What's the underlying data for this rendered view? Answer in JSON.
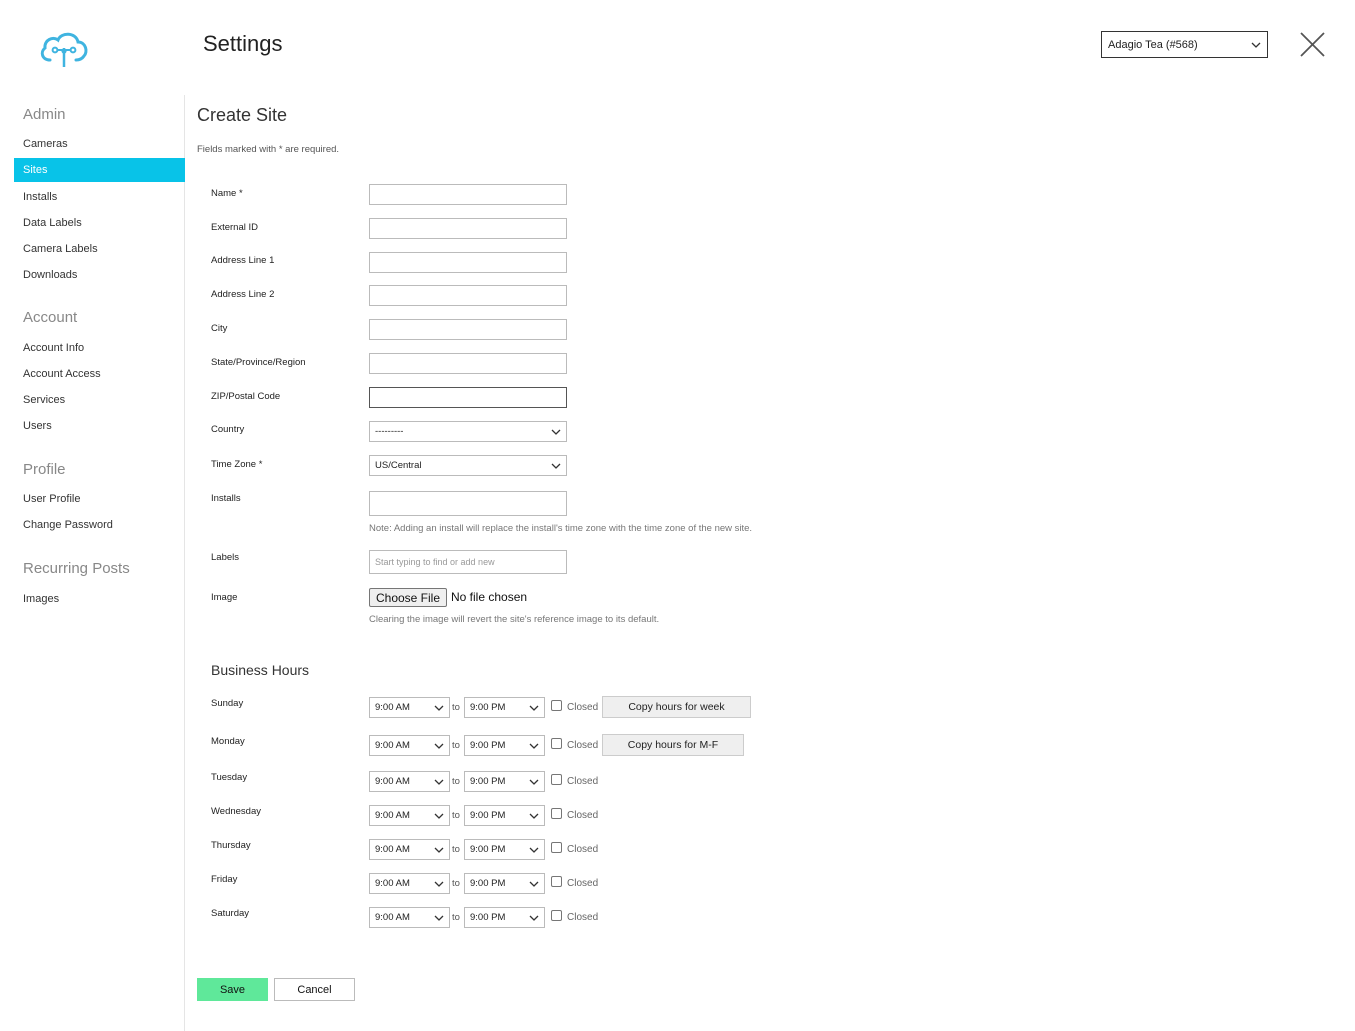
{
  "header": {
    "title": "Settings",
    "account_select": "Adagio Tea (#568)",
    "logo_icon": "cloud-logo-icon",
    "close_icon": "close-icon"
  },
  "colors": {
    "accent": "#08c3e8",
    "save": "#5fe89a",
    "logo": "#3fb4e0"
  },
  "sidebar": {
    "groups": [
      {
        "title": "Admin",
        "items": [
          "Cameras",
          "Sites",
          "Installs",
          "Data Labels",
          "Camera Labels",
          "Downloads"
        ]
      },
      {
        "title": "Account",
        "items": [
          "Account Info",
          "Account Access",
          "Services",
          "Users"
        ]
      },
      {
        "title": "Profile",
        "items": [
          "User Profile",
          "Change Password"
        ]
      },
      {
        "title": "Recurring Posts",
        "items": [
          "Images"
        ]
      }
    ],
    "active": "Sites"
  },
  "form": {
    "title": "Create Site",
    "required_note": "Fields marked with * are required.",
    "fields": {
      "name": {
        "label": "Name *",
        "value": ""
      },
      "external_id": {
        "label": "External ID",
        "value": ""
      },
      "address1": {
        "label": "Address Line 1",
        "value": ""
      },
      "address2": {
        "label": "Address Line 2",
        "value": ""
      },
      "city": {
        "label": "City",
        "value": ""
      },
      "state": {
        "label": "State/Province/Region",
        "value": ""
      },
      "zip": {
        "label": "ZIP/Postal Code",
        "value": ""
      },
      "country": {
        "label": "Country",
        "value": "---------"
      },
      "timezone": {
        "label": "Time Zone *",
        "value": "US/Central"
      },
      "installs": {
        "label": "Installs",
        "value": "",
        "note": "Note: Adding an install will replace the install's time zone with the time zone of the new site."
      },
      "labels": {
        "label": "Labels",
        "placeholder": "Start typing to find or add new"
      },
      "image": {
        "label": "Image",
        "button": "Choose File",
        "status": "No file chosen",
        "note": "Clearing the image will revert the site's reference image to its default."
      }
    },
    "business_hours": {
      "title": "Business Hours",
      "to_label": "to",
      "closed_label": "Closed",
      "days": [
        {
          "day": "Sunday",
          "open": "9:00 AM",
          "close": "9:00 PM",
          "closed": false,
          "copy_button": "Copy hours for week"
        },
        {
          "day": "Monday",
          "open": "9:00 AM",
          "close": "9:00 PM",
          "closed": false,
          "copy_button": "Copy hours for M-F"
        },
        {
          "day": "Tuesday",
          "open": "9:00 AM",
          "close": "9:00 PM",
          "closed": false
        },
        {
          "day": "Wednesday",
          "open": "9:00 AM",
          "close": "9:00 PM",
          "closed": false
        },
        {
          "day": "Thursday",
          "open": "9:00 AM",
          "close": "9:00 PM",
          "closed": false
        },
        {
          "day": "Friday",
          "open": "9:00 AM",
          "close": "9:00 PM",
          "closed": false
        },
        {
          "day": "Saturday",
          "open": "9:00 AM",
          "close": "9:00 PM",
          "closed": false
        }
      ]
    },
    "save_label": "Save",
    "cancel_label": "Cancel"
  }
}
